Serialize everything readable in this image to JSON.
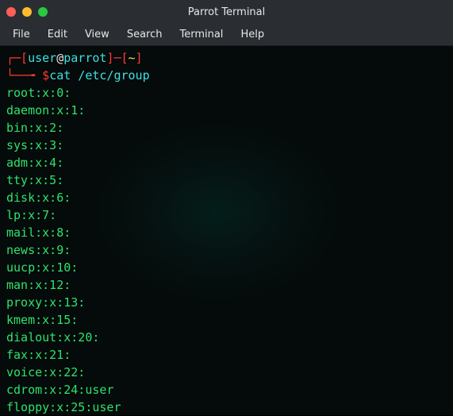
{
  "window": {
    "title": "Parrot Terminal"
  },
  "menu": {
    "items": [
      "File",
      "Edit",
      "View",
      "Search",
      "Terminal",
      "Help"
    ]
  },
  "prompt": {
    "line1_open": "┌─[",
    "user": "user",
    "at": "@",
    "host": "parrot",
    "line1_mid": "]─[",
    "cwd": "~",
    "line1_close": "]",
    "line2_box": "└──╼ ",
    "dollar": "$",
    "command": "cat /etc/group"
  },
  "output": [
    "root:x:0:",
    "daemon:x:1:",
    "bin:x:2:",
    "sys:x:3:",
    "adm:x:4:",
    "tty:x:5:",
    "disk:x:6:",
    "lp:x:7:",
    "mail:x:8:",
    "news:x:9:",
    "uucp:x:10:",
    "man:x:12:",
    "proxy:x:13:",
    "kmem:x:15:",
    "dialout:x:20:",
    "fax:x:21:",
    "voice:x:22:",
    "cdrom:x:24:user",
    "floppy:x:25:user"
  ]
}
